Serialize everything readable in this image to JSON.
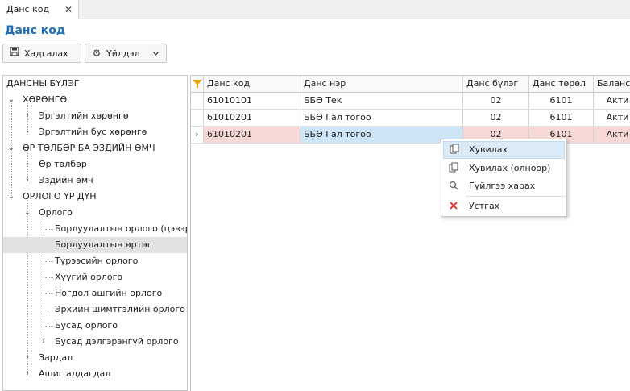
{
  "tab": {
    "label": "Данс код",
    "close": "✕"
  },
  "page_title": "Данс код",
  "toolbar": {
    "save_label": "Хадгалах",
    "actions_label": "Үйлдэл"
  },
  "tree": {
    "header": "ДАНСНЫ БҮЛЭГ",
    "items": [
      {
        "label": "ХӨРӨНГӨ"
      },
      {
        "label": "Эргэлтийн хөрөнгө"
      },
      {
        "label": "Эргэлтийн бус хөрөнгө"
      },
      {
        "label": "ӨР ТӨЛБӨР БА ЭЗДИЙН ӨМЧ"
      },
      {
        "label": "Өр төлбөр"
      },
      {
        "label": "Эздийн өмч"
      },
      {
        "label": "ОРЛОГО ҮР ДҮН"
      },
      {
        "label": "Орлого"
      },
      {
        "label": "Борлуулалтын орлого (цэвэр)"
      },
      {
        "label": "Борлуулалтын өртөг"
      },
      {
        "label": "Түрээсийн орлого"
      },
      {
        "label": "Хүүгий орлого"
      },
      {
        "label": "Ногдол ашгийн орлого"
      },
      {
        "label": "Эрхийн шимтгэлийн орлого"
      },
      {
        "label": "Бусад орлого"
      },
      {
        "label": "Бусад дэлгэрэнгүй орлого"
      },
      {
        "label": "Зардал"
      },
      {
        "label": "Ашиг алдагдал"
      }
    ]
  },
  "grid": {
    "columns": [
      "Данс код",
      "Данс нэр",
      "Данс бүлэг",
      "Данс төрөл",
      "Баланс на"
    ],
    "rows": [
      [
        "61010101",
        "ББӨ Тек",
        "02",
        "6101",
        "Акти"
      ],
      [
        "61010201",
        "ББӨ Гал тогоо",
        "02",
        "6101",
        "Акти"
      ],
      [
        "61010201",
        "ББӨ Гал тогоо",
        "02",
        "6101",
        "Акти"
      ]
    ]
  },
  "context_menu": {
    "items": [
      {
        "label": "Хувилах",
        "icon": "copy-icon"
      },
      {
        "label": "Хувилах (олноор)",
        "icon": "copy-multiple-icon"
      },
      {
        "label": "Гүйлгээ харах",
        "icon": "search-icon"
      },
      {
        "label": "Устгах",
        "icon": "delete-icon"
      }
    ]
  },
  "colors": {
    "title": "#1f6fb5",
    "selected_row": "#f6d9d6",
    "focused_cell": "#cde5f7",
    "delete_icon": "#e53935",
    "filter_icon": "#e6a700"
  }
}
